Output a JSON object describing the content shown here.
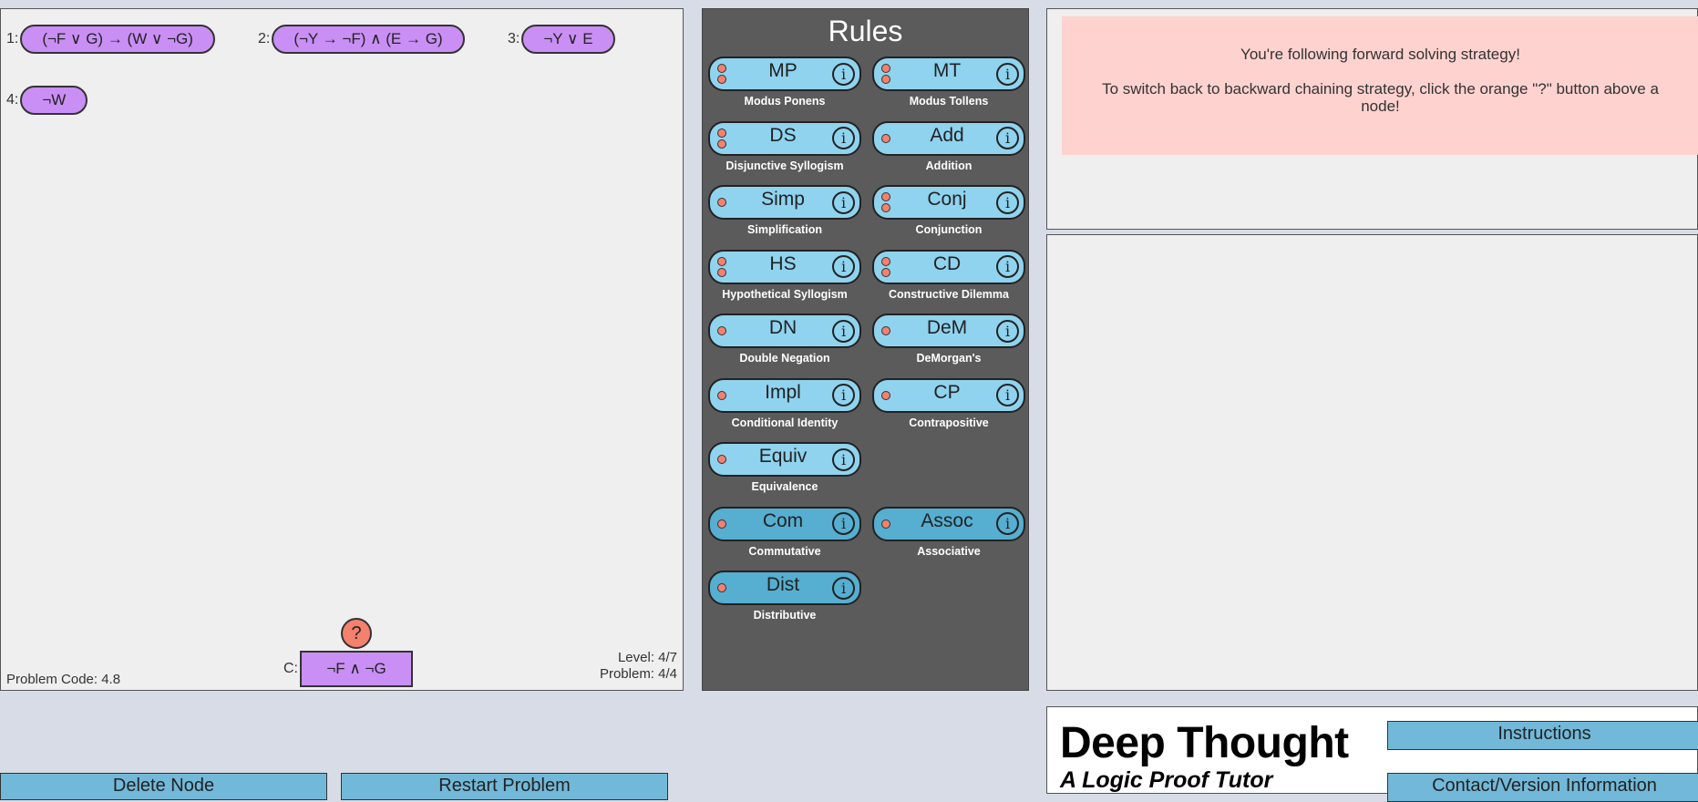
{
  "workspace": {
    "premises": [
      {
        "index": "1:",
        "formula": "(¬F ∨ G) → (W ∨ ¬G)"
      },
      {
        "index": "2:",
        "formula": "(¬Y → ¬F) ∧ (E → G)"
      },
      {
        "index": "3:",
        "formula": "¬Y ∨ E"
      },
      {
        "index": "4:",
        "formula": "¬W"
      }
    ],
    "conclusion": {
      "index": "C:",
      "formula": "¬F ∧ ¬G"
    },
    "help_button": "?",
    "problem_code": "Problem Code: 4.8",
    "level": "Level: 4/7",
    "problem": "Problem: 4/4"
  },
  "rules": {
    "title": "Rules",
    "info_glyph": "i",
    "items": [
      {
        "abbr": "MP",
        "name": "Modus Ponens",
        "inputs": 2,
        "style": "light"
      },
      {
        "abbr": "MT",
        "name": "Modus Tollens",
        "inputs": 2,
        "style": "light"
      },
      {
        "abbr": "DS",
        "name": "Disjunctive Syllogism",
        "inputs": 2,
        "style": "light"
      },
      {
        "abbr": "Add",
        "name": "Addition",
        "inputs": 1,
        "style": "light"
      },
      {
        "abbr": "Simp",
        "name": "Simplification",
        "inputs": 1,
        "style": "light"
      },
      {
        "abbr": "Conj",
        "name": "Conjunction",
        "inputs": 2,
        "style": "light"
      },
      {
        "abbr": "HS",
        "name": "Hypothetical Syllogism",
        "inputs": 2,
        "style": "light"
      },
      {
        "abbr": "CD",
        "name": "Constructive Dilemma",
        "inputs": 2,
        "style": "light"
      },
      {
        "abbr": "DN",
        "name": "Double Negation",
        "inputs": 1,
        "style": "light"
      },
      {
        "abbr": "DeM",
        "name": "DeMorgan's",
        "inputs": 1,
        "style": "light"
      },
      {
        "abbr": "Impl",
        "name": "Conditional Identity",
        "inputs": 1,
        "style": "light"
      },
      {
        "abbr": "CP",
        "name": "Contrapositive",
        "inputs": 1,
        "style": "light"
      },
      {
        "abbr": "Equiv",
        "name": "Equivalence",
        "inputs": 1,
        "style": "light"
      },
      {
        "abbr": "Com",
        "name": "Commutative",
        "inputs": 1,
        "style": "dark"
      },
      {
        "abbr": "Assoc",
        "name": "Associative",
        "inputs": 1,
        "style": "dark"
      },
      {
        "abbr": "Dist",
        "name": "Distributive",
        "inputs": 1,
        "style": "dark"
      }
    ]
  },
  "message": {
    "line1": "You're following forward solving strategy!",
    "line2": "To switch back to backward chaining strategy, click the orange \"?\" button above a node!"
  },
  "buttons": {
    "delete_node": "Delete Node",
    "restart_problem": "Restart Problem",
    "instructions": "Instructions",
    "contact": "Contact/Version Information"
  },
  "brand": {
    "title": "Deep Thought",
    "subtitle": "A Logic Proof Tutor"
  },
  "colors": {
    "node_fill": "#c98ff5",
    "rule_light": "#8fd3ef",
    "rule_dark": "#56aed0",
    "help_orange": "#f4806e",
    "message_bg": "#fed2cf",
    "rules_bg": "#5b5b5b",
    "button_blue": "#72b8d8"
  }
}
